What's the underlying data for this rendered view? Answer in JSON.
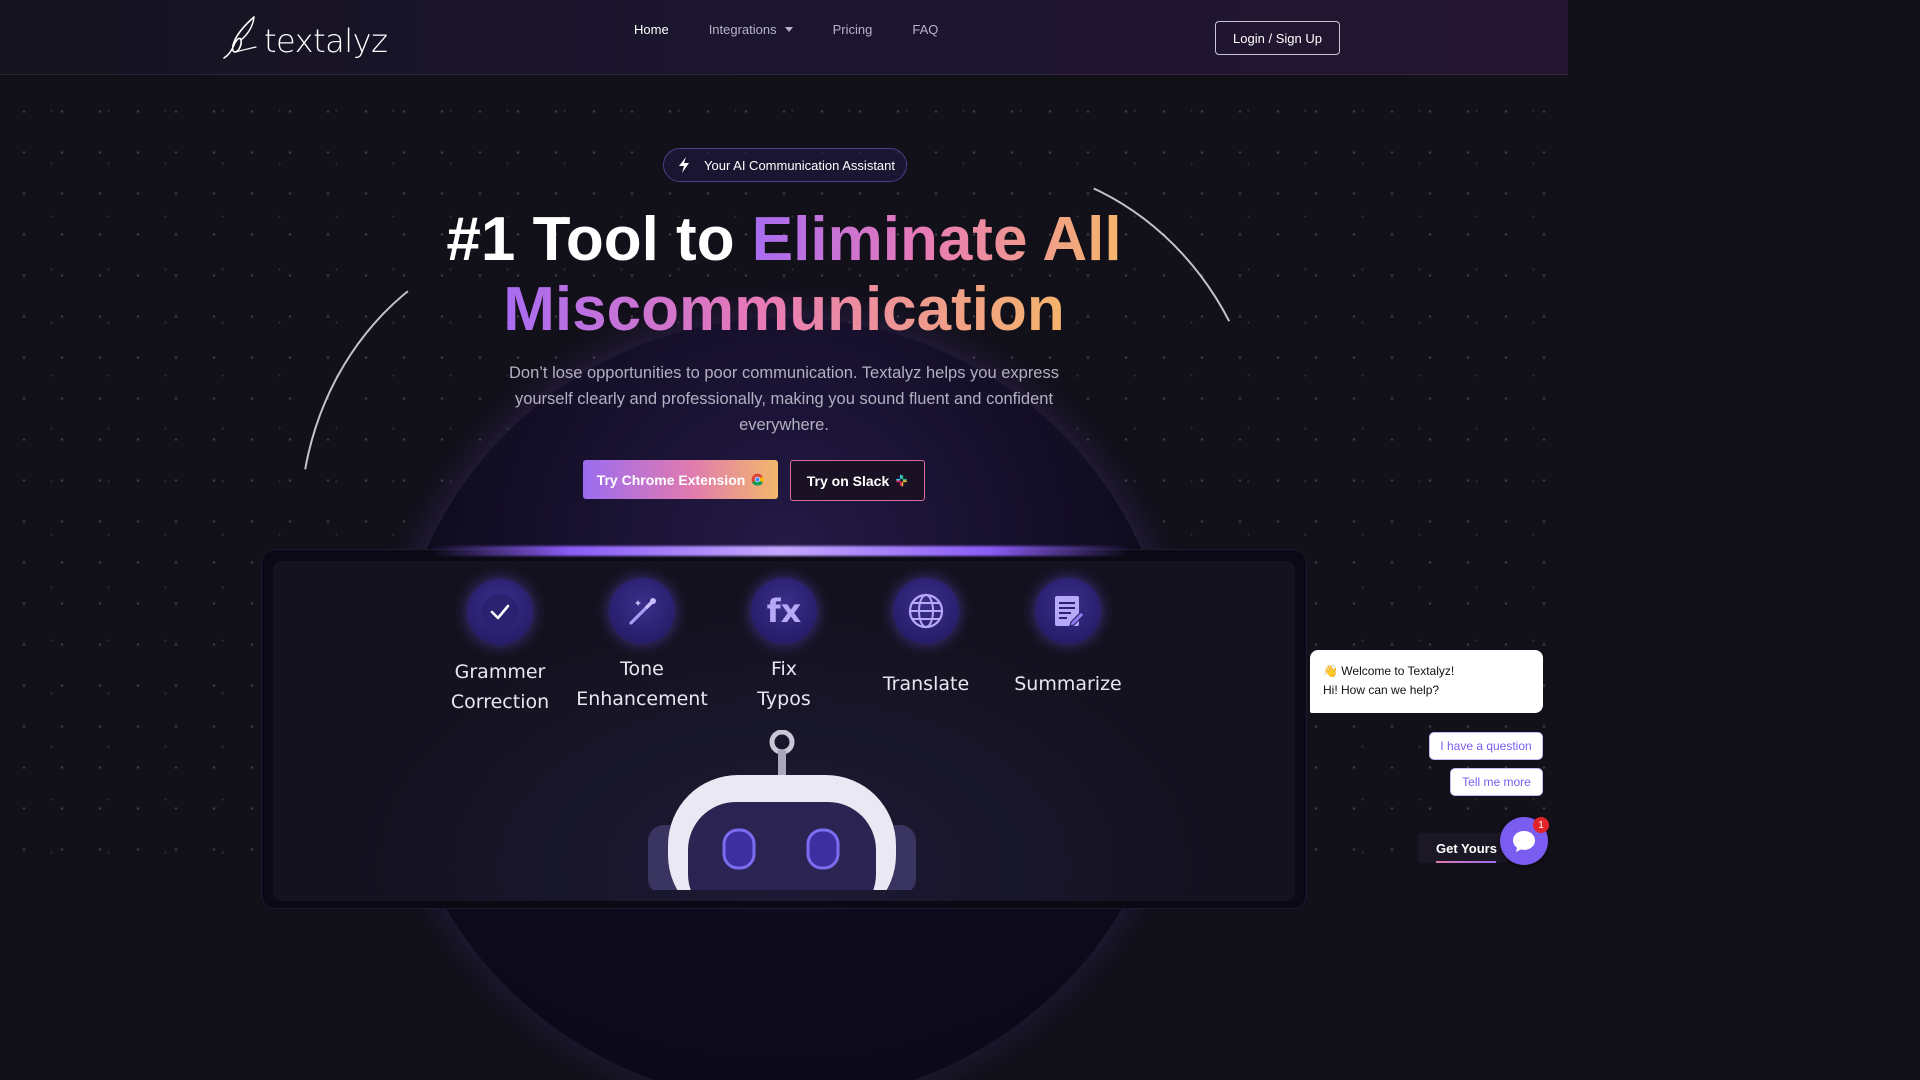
{
  "header": {
    "logo_text": "textalyz",
    "nav": [
      {
        "label": "Home"
      },
      {
        "label": "Integrations"
      },
      {
        "label": "Pricing"
      },
      {
        "label": "FAQ"
      }
    ],
    "login_label": "Login / Sign Up"
  },
  "hero": {
    "badge": "Your AI Communication Assistant",
    "headline_plain": "#1 Tool to ",
    "headline_accent_1": "Eliminate All",
    "headline_accent_2": "Miscommunication",
    "subtitle": "Don’t lose opportunities to poor communication. Textalyz helps you express yourself clearly and professionally, making you sound fluent and confident everywhere.",
    "cta_chrome": "Try Chrome Extension",
    "cta_slack": "Try on Slack"
  },
  "features": [
    {
      "line1": "Grammer",
      "line2": "Correction",
      "icon": "check-icon"
    },
    {
      "line1": "Tone",
      "line2": "Enhancement",
      "icon": "magic-wand-icon"
    },
    {
      "line1": "Fix",
      "line2": "Typos",
      "icon": "fx-icon"
    },
    {
      "line1": "Translate",
      "line2": "",
      "icon": "globe-icon"
    },
    {
      "line1": "Summarize",
      "line2": "",
      "icon": "document-edit-icon"
    }
  ],
  "chat": {
    "welcome": "Welcome to Textalyz!",
    "help": "Hi! How can we help?",
    "option_1": "I have a question",
    "option_2": "Tell me more",
    "cta": "Get Yours T",
    "unread": "1"
  },
  "colors": {
    "accent_purple": "#a86cf2",
    "accent_pink": "#e879b8",
    "accent_orange": "#f5b56b",
    "background": "#121019"
  }
}
